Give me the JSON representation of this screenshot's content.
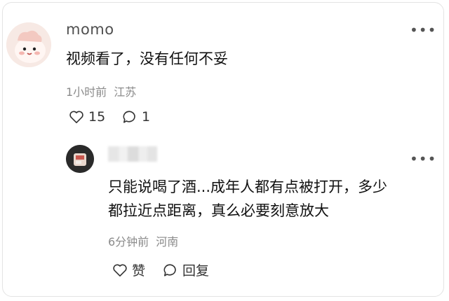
{
  "comment": {
    "username": "momo",
    "text": "视频看了，没有任何不妥",
    "time": "1小时前",
    "location": "江苏",
    "like_count": "15",
    "comment_count": "1"
  },
  "reply": {
    "text_line1": "只能说喝了酒...成年人都有点被打开，多少",
    "text_line2": "都拉近点距离，真么必要刻意放大",
    "time": "6分钟前",
    "location": "河南",
    "like_label": "赞",
    "reply_label": "回复"
  },
  "icons": {
    "more": "more-horizontal-icon",
    "like": "heart-outline-icon",
    "comment": "speech-bubble-icon"
  },
  "colors": {
    "text": "#111111",
    "meta": "#8b8b8b",
    "username": "#505050",
    "avatar_main_bg": "#f7e9e4"
  }
}
